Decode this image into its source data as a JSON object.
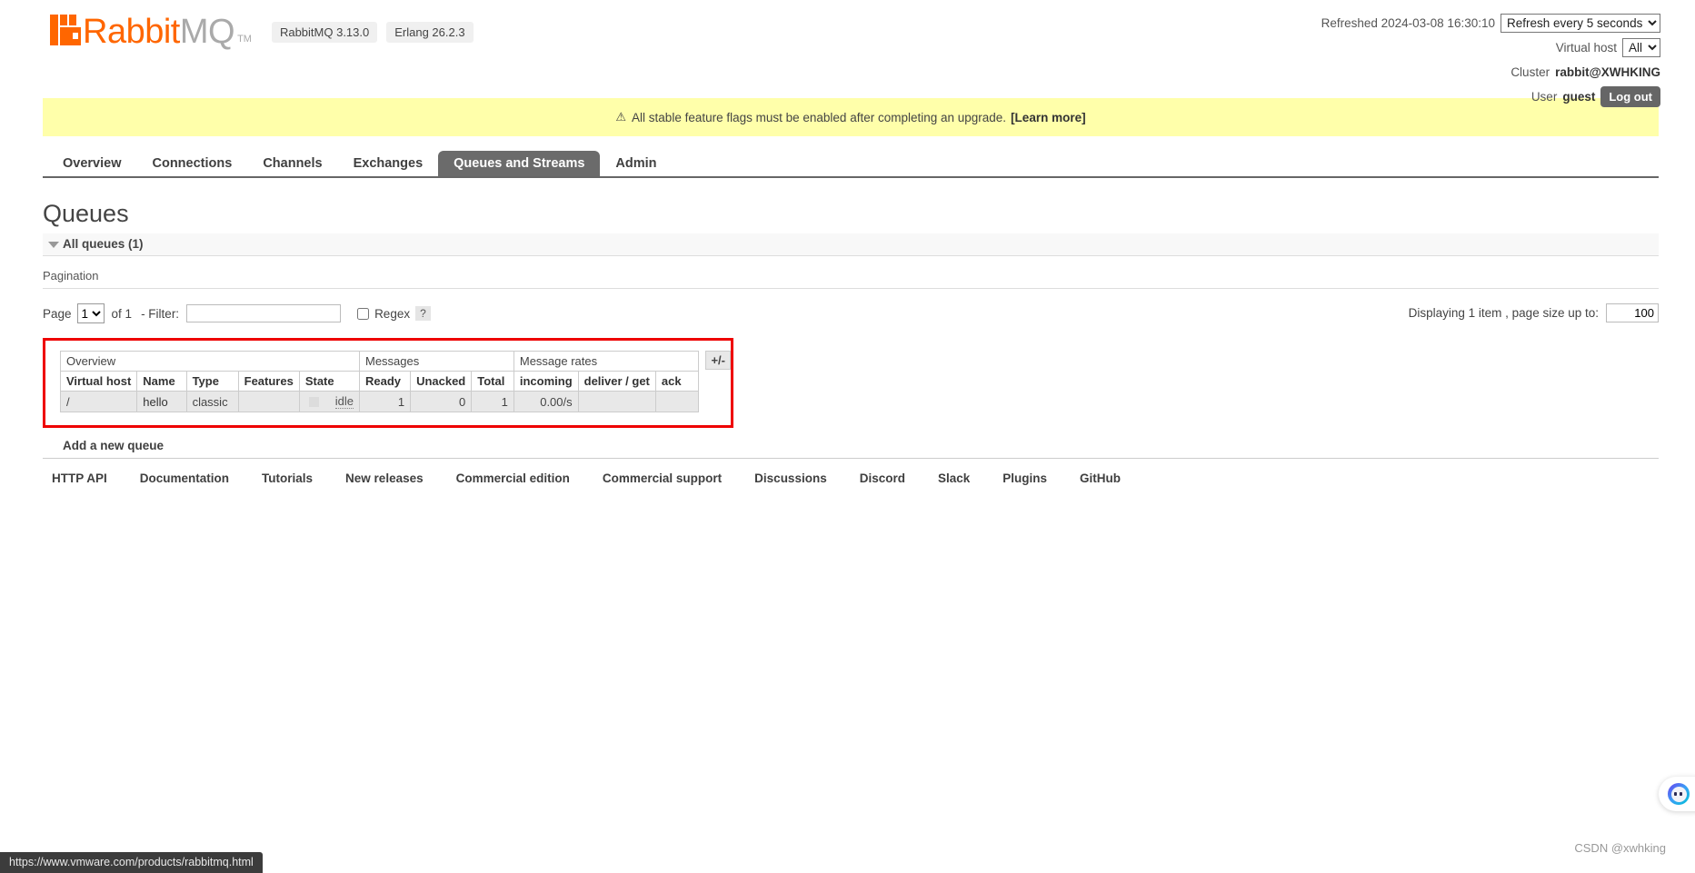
{
  "header": {
    "logo_rabbit": "Rabbit",
    "logo_mq": "MQ",
    "logo_tm": "TM",
    "badge_rabbitmq": "RabbitMQ 3.13.0",
    "badge_erlang": "Erlang 26.2.3",
    "refreshed_label": "Refreshed 2024-03-08 16:30:10",
    "refresh_option": "Refresh every 5 seconds",
    "vhost_label": "Virtual host",
    "vhost_value": "All",
    "cluster_label": "Cluster",
    "cluster_value": "rabbit@XWHKING",
    "user_label": "User",
    "user_value": "guest",
    "logout_label": "Log out"
  },
  "warning": {
    "icon": "warning-triangle-icon",
    "text": "All stable feature flags must be enabled after completing an upgrade.",
    "link_label": "[Learn more]"
  },
  "tabs": [
    {
      "label": "Overview",
      "active": false
    },
    {
      "label": "Connections",
      "active": false
    },
    {
      "label": "Channels",
      "active": false
    },
    {
      "label": "Exchanges",
      "active": false
    },
    {
      "label": "Queues and Streams",
      "active": true
    },
    {
      "label": "Admin",
      "active": false
    }
  ],
  "main": {
    "page_title": "Queues",
    "all_queues_label": "All queues (1)",
    "pagination_label": "Pagination",
    "page_label": "Page",
    "page_value": "1",
    "of_text": "of 1",
    "filter_label": "- Filter:",
    "filter_value": "",
    "filter_placeholder": "",
    "regex_label": "Regex",
    "help_badge": "?",
    "displaying_text": "Displaying 1 item , page size up to:",
    "page_size_value": "100",
    "plus_minus_label": "+/-",
    "add_queue_label": "Add a new queue"
  },
  "table": {
    "groups": [
      {
        "label": "Overview",
        "span": 5
      },
      {
        "label": "Messages",
        "span": 3
      },
      {
        "label": "Message rates",
        "span": 3
      }
    ],
    "columns": [
      {
        "label": "Virtual host",
        "align": "left"
      },
      {
        "label": "Name",
        "align": "left"
      },
      {
        "label": "Type",
        "align": "left"
      },
      {
        "label": "Features",
        "align": "left"
      },
      {
        "label": "State",
        "align": "left"
      },
      {
        "label": "Ready",
        "align": "right"
      },
      {
        "label": "Unacked",
        "align": "right"
      },
      {
        "label": "Total",
        "align": "right"
      },
      {
        "label": "incoming",
        "align": "right"
      },
      {
        "label": "deliver / get",
        "align": "left"
      },
      {
        "label": "ack",
        "align": "left"
      }
    ],
    "rows": [
      {
        "virtual_host": "/",
        "name": "hello",
        "type": "classic",
        "features": "",
        "state": "idle",
        "ready": "1",
        "unacked": "0",
        "total": "1",
        "incoming": "0.00/s",
        "deliver_get": "",
        "ack": ""
      }
    ]
  },
  "footer": {
    "links": [
      "HTTP API",
      "Documentation",
      "Tutorials",
      "New releases",
      "Commercial edition",
      "Commercial support",
      "Discussions",
      "Discord",
      "Slack",
      "Plugins",
      "GitHub"
    ]
  },
  "overlay": {
    "status_url": "https://www.vmware.com/products/rabbitmq.html",
    "watermark": "CSDN @xwhking"
  },
  "colors": {
    "brand_orange": "#ff6600",
    "active_tab": "#6b6b6b",
    "warning_bg": "#ffffaa",
    "highlight_red": "#ee0000"
  }
}
